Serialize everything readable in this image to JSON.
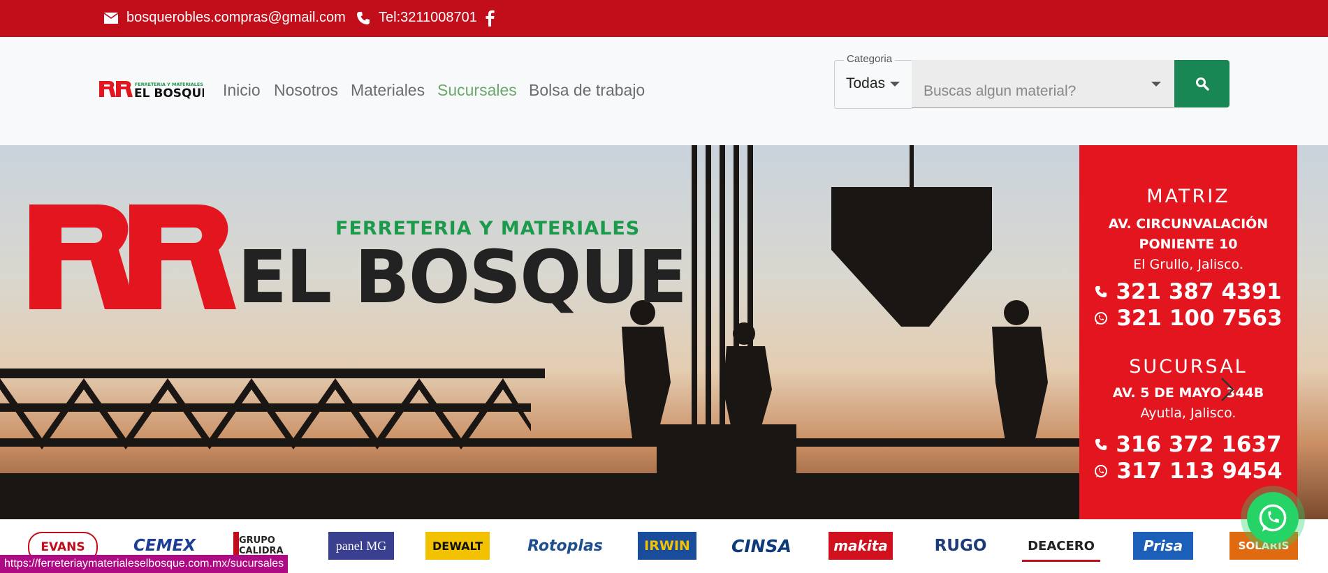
{
  "topbar": {
    "email": "bosquerobles.compras@gmail.com",
    "phone": "Tel:3211008701"
  },
  "header": {
    "logo_top": "FERRETERIA Y MATERIALES",
    "logo_main": "EL BOSQUE",
    "nav": [
      "Inicio",
      "Nosotros",
      "Materiales",
      "Sucursales",
      "Bolsa de trabajo"
    ],
    "active_nav": "Sucursales"
  },
  "search": {
    "category_label": "Categoria",
    "category_value": "Todas",
    "placeholder": "Buscas algun material?"
  },
  "hero": {
    "brand_sub": "FERRETERIA Y MATERIALES",
    "brand_main": "EL BOSQUE",
    "matriz_title": "MATRIZ",
    "matriz_address_1": "AV. CIRCUNVALACIÓN",
    "matriz_address_2": "PONIENTE 10",
    "matriz_city": "El Grullo, Jalisco.",
    "matriz_phone": "321 387 4391",
    "matriz_whatsapp": "321 100 7563",
    "sucursal_title": "SUCURSAL",
    "sucursal_address": "AV. 5 DE MAYO 344B",
    "sucursal_city": "Ayutla, Jalisco.",
    "sucursal_phone": "316 372 1637",
    "sucursal_whatsapp": "317 113 9454"
  },
  "brands": [
    "EVANS",
    "CEMEX",
    "GRUPO CALIDRA",
    "panel MG",
    "DEWALT",
    "Rotoplas",
    "IRWIN",
    "CINSA",
    "makita",
    "RUGO",
    "DEACERO",
    "Prisa",
    "SOLARIS"
  ],
  "status_url": "https://ferreteriaymaterialeselbosque.com.mx/sucursales",
  "colors": {
    "topbar": "#c20e1a",
    "search_button": "#198754",
    "active_nav": "#6aa968",
    "ad_panel": "#e3151f",
    "whatsapp": "#25d366"
  },
  "icons": {
    "email": "envelope-icon",
    "phone": "phone-icon",
    "facebook": "facebook-icon",
    "search": "search-icon",
    "whatsapp": "whatsapp-icon",
    "carousel_next": "chevron-right-icon"
  }
}
